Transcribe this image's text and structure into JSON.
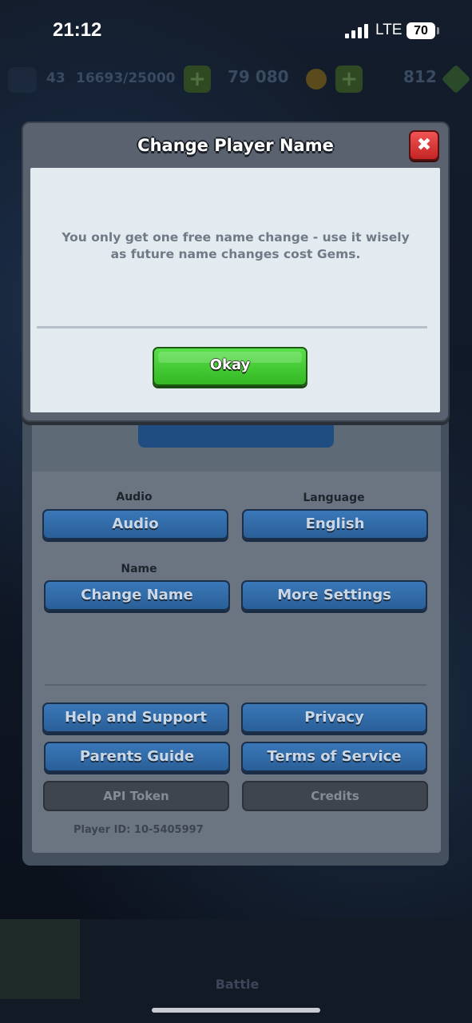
{
  "status_bar": {
    "time": "21:12",
    "network": "LTE",
    "battery": "70"
  },
  "background": {
    "level": "43",
    "xp": "16693/25000",
    "gold": "79 080",
    "gems": "812",
    "battle_label": "Battle"
  },
  "dialog": {
    "title": "Change Player Name",
    "message": "You only get one free name change - use it wisely as future name changes cost Gems.",
    "ok_label": "Okay",
    "close_icon": "close-icon"
  },
  "settings": {
    "audio_label": "Audio",
    "audio_button": "Audio",
    "language_label": "Language",
    "language_button": "English",
    "name_label": "Name",
    "change_name_button": "Change Name",
    "more_settings_button": "More Settings",
    "help_button": "Help and Support",
    "privacy_button": "Privacy",
    "parents_button": "Parents Guide",
    "terms_button": "Terms of Service",
    "api_token_button": "API Token",
    "credits_button": "Credits",
    "player_id": "Player ID: 10-5405997"
  },
  "colors": {
    "ok_green": "#33b824",
    "close_red": "#c42424",
    "settings_blue": "#2a5f98"
  }
}
